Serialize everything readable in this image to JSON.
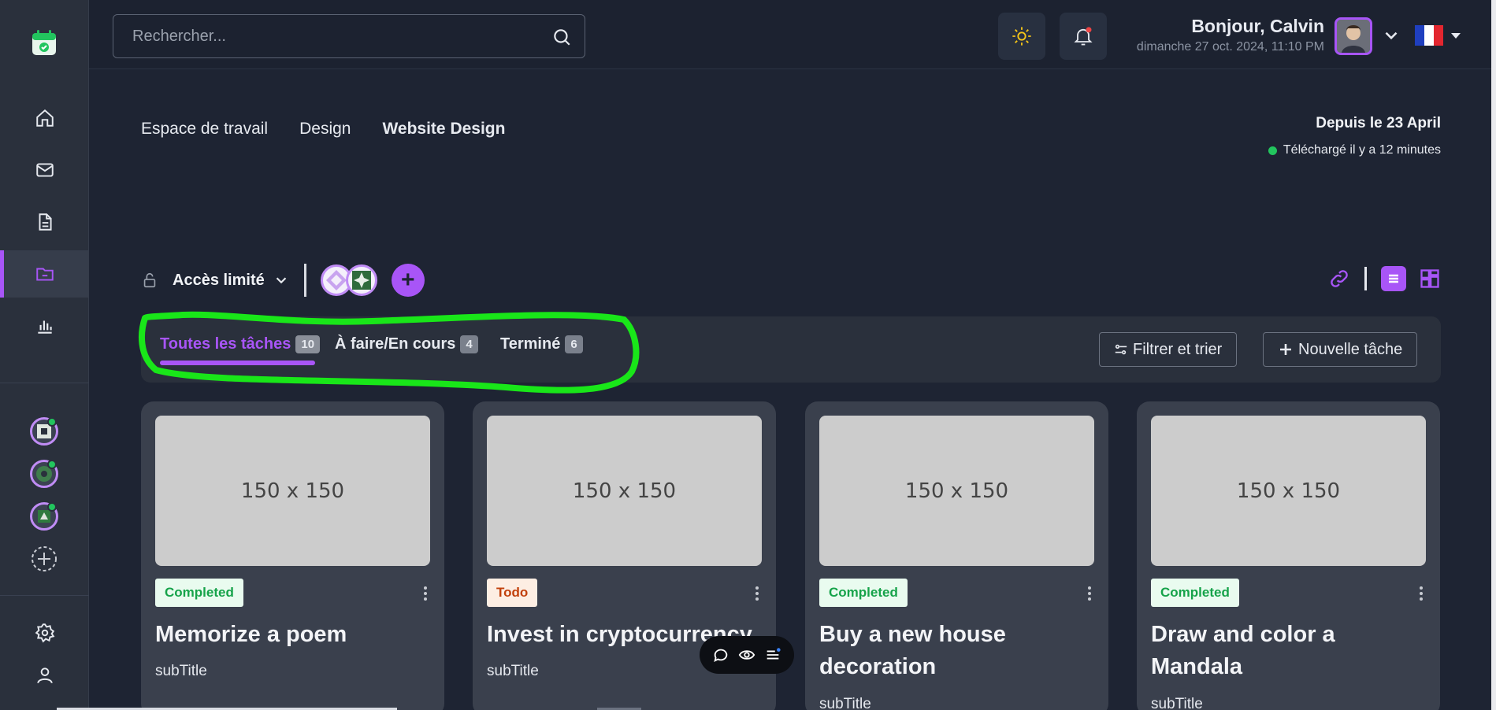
{
  "topbar": {
    "search_placeholder": "Rechercher...",
    "greeting": "Bonjour, Calvin",
    "date": "dimanche 27 oct. 2024, 11:10 PM"
  },
  "breadcrumb": {
    "items": [
      "Espace de travail",
      "Design"
    ],
    "current": "Website Design"
  },
  "meta": {
    "since": "Depuis le 23 April",
    "uploaded": "Téléchargé il y a 12 minutes"
  },
  "access": {
    "label": "Accès limité",
    "add_symbol": "+"
  },
  "tabs": [
    {
      "label": "Toutes les tâches",
      "count": "10"
    },
    {
      "label": "À faire/En cours",
      "count": "4"
    },
    {
      "label": "Terminé",
      "count": "6"
    }
  ],
  "actions": {
    "filter": "Filtrer et trier",
    "new_task": "Nouvelle tâche"
  },
  "cards": [
    {
      "thumb": "150 x 150",
      "status": "Completed",
      "title": "Memorize a poem",
      "subtitle": "subTitle"
    },
    {
      "thumb": "150 x 150",
      "status": "Todo",
      "title": "Invest in cryptocurrency",
      "subtitle": "subTitle"
    },
    {
      "thumb": "150 x 150",
      "status": "Completed",
      "title": "Buy a new house decoration",
      "subtitle": "subTitle"
    },
    {
      "thumb": "150 x 150",
      "status": "Completed",
      "title": "Draw and color a Mandala",
      "subtitle": "subTitle"
    }
  ],
  "colors": {
    "accent": "#a855f7",
    "background": "#1e2433",
    "sidebar": "#2a303c",
    "card": "#3a404d",
    "online": "#22c55e",
    "highlight_annotation": "#19e619"
  },
  "icons": {
    "sidebar": [
      "calendar-logo-icon",
      "home-icon",
      "mail-icon",
      "document-icon",
      "folder-icon",
      "chart-icon",
      "add-workspace-icon",
      "settings-icon",
      "user-icon"
    ],
    "topbar": [
      "search-icon",
      "sun-icon",
      "bell-icon",
      "chevron-down-icon",
      "flag-fr-icon"
    ]
  }
}
